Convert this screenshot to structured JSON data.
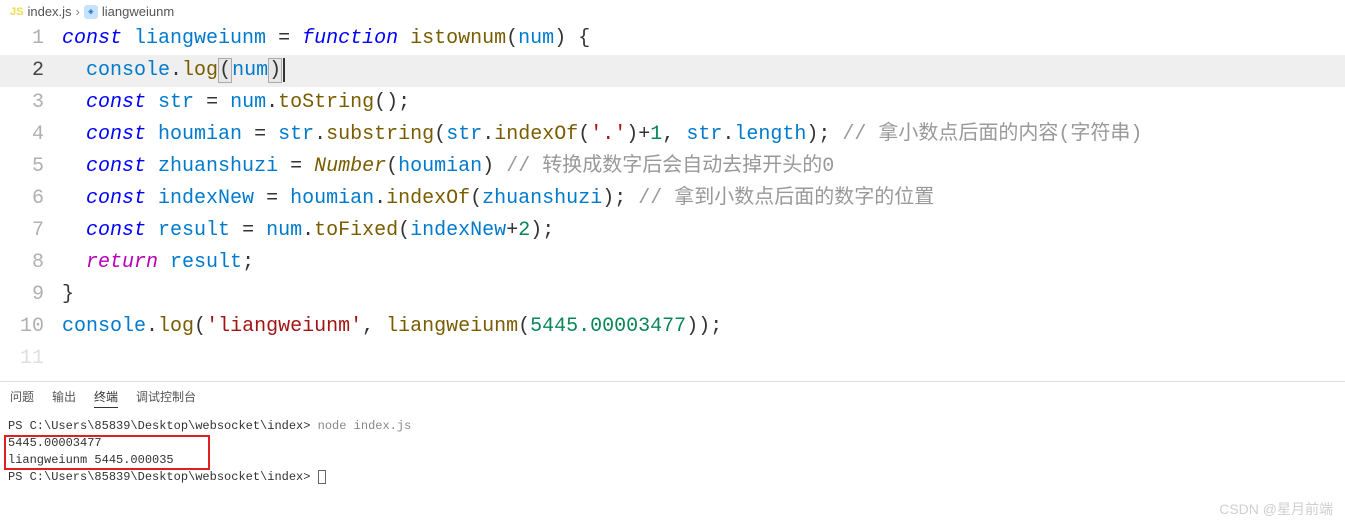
{
  "breadcrumb": {
    "file_icon": "JS",
    "file": "index.js",
    "sep": "›",
    "symbol_icon": "◈",
    "symbol": "liangweiunm"
  },
  "editor": {
    "lines": {
      "1": {
        "num": "1"
      },
      "2": {
        "num": "2"
      },
      "3": {
        "num": "3"
      },
      "4": {
        "num": "4"
      },
      "5": {
        "num": "5"
      },
      "6": {
        "num": "6"
      },
      "7": {
        "num": "7"
      },
      "8": {
        "num": "8"
      },
      "9": {
        "num": "9"
      },
      "10": {
        "num": "10"
      },
      "11": {
        "num": "11"
      }
    },
    "tokens": {
      "const": "const",
      "function": "function",
      "return": "return",
      "liangweiunm": "liangweiunm",
      "istownum": "istownum",
      "num": "num",
      "console": "console",
      "log": "log",
      "str": "str",
      "toString": "toString",
      "houmian": "houmian",
      "substring": "substring",
      "indexOf": "indexOf",
      "length": "length",
      "zhuanshuzi": "zhuanshuzi",
      "Number": "Number",
      "indexNew": "indexNew",
      "result": "result",
      "toFixed": "toFixed",
      "dot_str": "'.'",
      "liangweiunm_str": "'liangweiunm'",
      "n1": "1",
      "n2": "2",
      "bignum": "5445.00003477",
      "comment4": "// 拿小数点后面的内容(字符串)",
      "comment5": "// 转换成数字后会自动去掉开头的0",
      "comment6": "// 拿到小数点后面的数字的位置"
    }
  },
  "panel": {
    "tabs": {
      "problems": "问题",
      "output": "输出",
      "terminal": "终端",
      "debug": "调试控制台"
    }
  },
  "terminal": {
    "prompt1_path": "PS C:\\Users\\85839\\Desktop\\websocket\\index>",
    "prompt1_cmd": " node index.js",
    "out1": "5445.00003477",
    "out2": "liangweiunm 5445.000035",
    "prompt2_path": "PS C:\\Users\\85839\\Desktop\\websocket\\index>"
  },
  "watermark": "CSDN @星月前端"
}
